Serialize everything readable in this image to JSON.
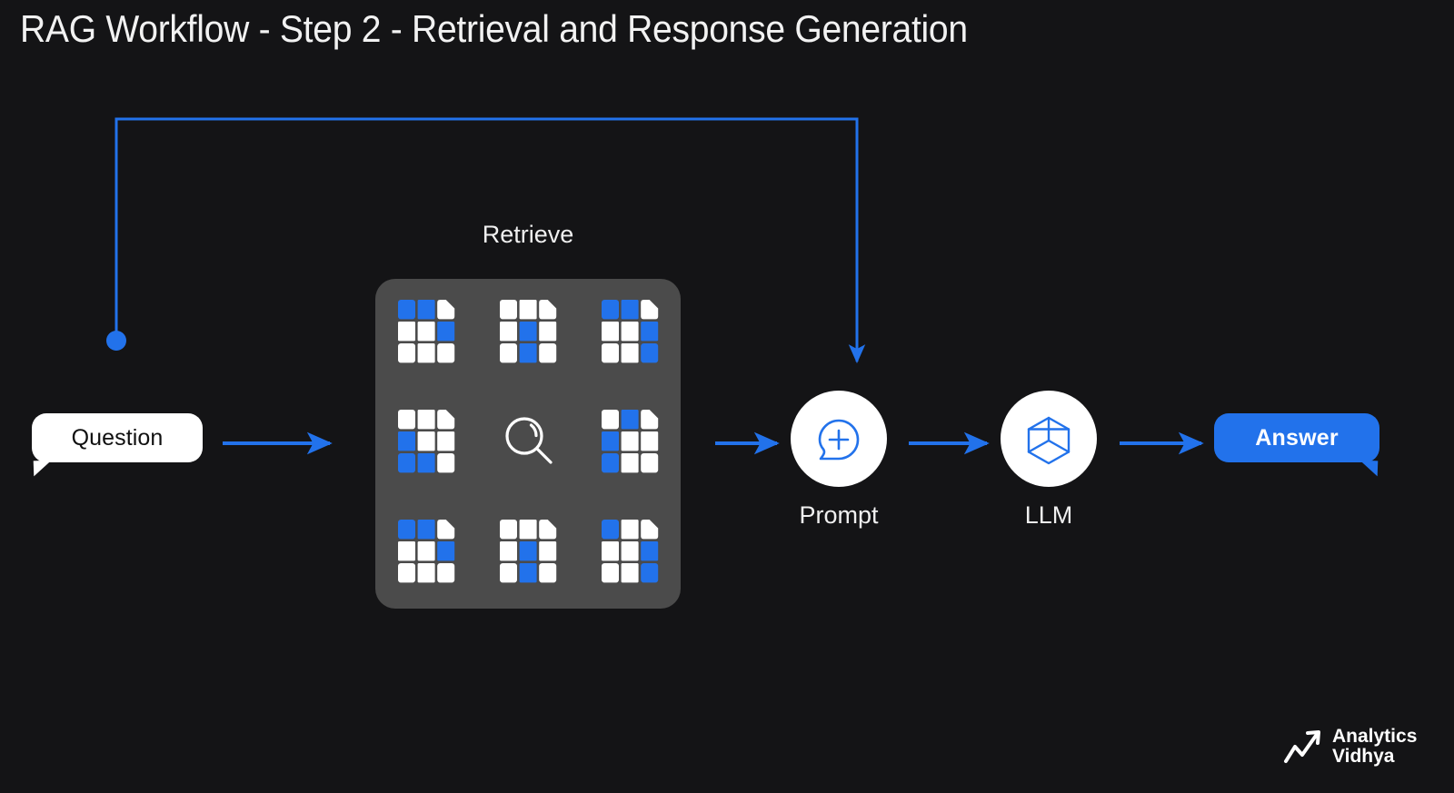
{
  "title": "RAG Workflow - Step 2 - Retrieval and Response Generation",
  "colors": {
    "background": "#141416",
    "accent_blue": "#2272eb",
    "panel_grey": "#4b4b4b",
    "bubble_white": "#ffffff",
    "text_white": "#f0f0f0"
  },
  "nodes": {
    "question": {
      "label": "Question",
      "shape": "speech-bubble",
      "fill": "#ffffff",
      "text_color": "#101010"
    },
    "retrieve": {
      "label": "Retrieve",
      "panel_fill": "#4b4b4b",
      "icon_count": 8,
      "center_icon": "magnifier-icon"
    },
    "prompt": {
      "label": "Prompt",
      "icon": "prompt-plus-bubble-icon",
      "icon_color": "#2272eb"
    },
    "llm": {
      "label": "LLM",
      "icon": "hexagon-cube-icon",
      "icon_color": "#2272eb"
    },
    "answer": {
      "label": "Answer",
      "shape": "speech-bubble",
      "fill": "#2272eb",
      "text_color": "#ffffff"
    }
  },
  "documents": [
    {
      "id": "doc-1",
      "blue_cells": [
        [
          0,
          0
        ],
        [
          0,
          1
        ],
        [
          1,
          2
        ]
      ]
    },
    {
      "id": "doc-2",
      "blue_cells": [
        [
          1,
          1
        ],
        [
          2,
          1
        ]
      ]
    },
    {
      "id": "doc-3",
      "blue_cells": [
        [
          0,
          0
        ],
        [
          0,
          1
        ],
        [
          1,
          2
        ],
        [
          2,
          2
        ]
      ]
    },
    {
      "id": "doc-4",
      "blue_cells": [
        [
          1,
          0
        ],
        [
          2,
          0
        ],
        [
          2,
          1
        ]
      ]
    },
    {
      "id": "doc-5",
      "blue_cells": [
        [
          0,
          1
        ],
        [
          1,
          0
        ],
        [
          2,
          0
        ]
      ]
    },
    {
      "id": "doc-6",
      "blue_cells": [
        [
          0,
          0
        ],
        [
          0,
          1
        ],
        [
          1,
          2
        ]
      ]
    },
    {
      "id": "doc-7",
      "blue_cells": [
        [
          1,
          1
        ],
        [
          2,
          1
        ]
      ]
    },
    {
      "id": "doc-8",
      "blue_cells": [
        [
          0,
          0
        ],
        [
          1,
          2
        ],
        [
          2,
          2
        ]
      ]
    }
  ],
  "connections": [
    {
      "from": "question",
      "to": "retrieve",
      "style": "arrow"
    },
    {
      "from": "retrieve",
      "to": "prompt",
      "style": "arrow"
    },
    {
      "from": "prompt",
      "to": "llm",
      "style": "arrow"
    },
    {
      "from": "llm",
      "to": "answer",
      "style": "arrow"
    },
    {
      "from": "question-origin-dot",
      "to": "prompt",
      "style": "loop-arrow-over-top"
    }
  ],
  "brand": {
    "line1": "Analytics",
    "line2": "Vidhya",
    "icon": "trend-up-arrow-icon"
  }
}
